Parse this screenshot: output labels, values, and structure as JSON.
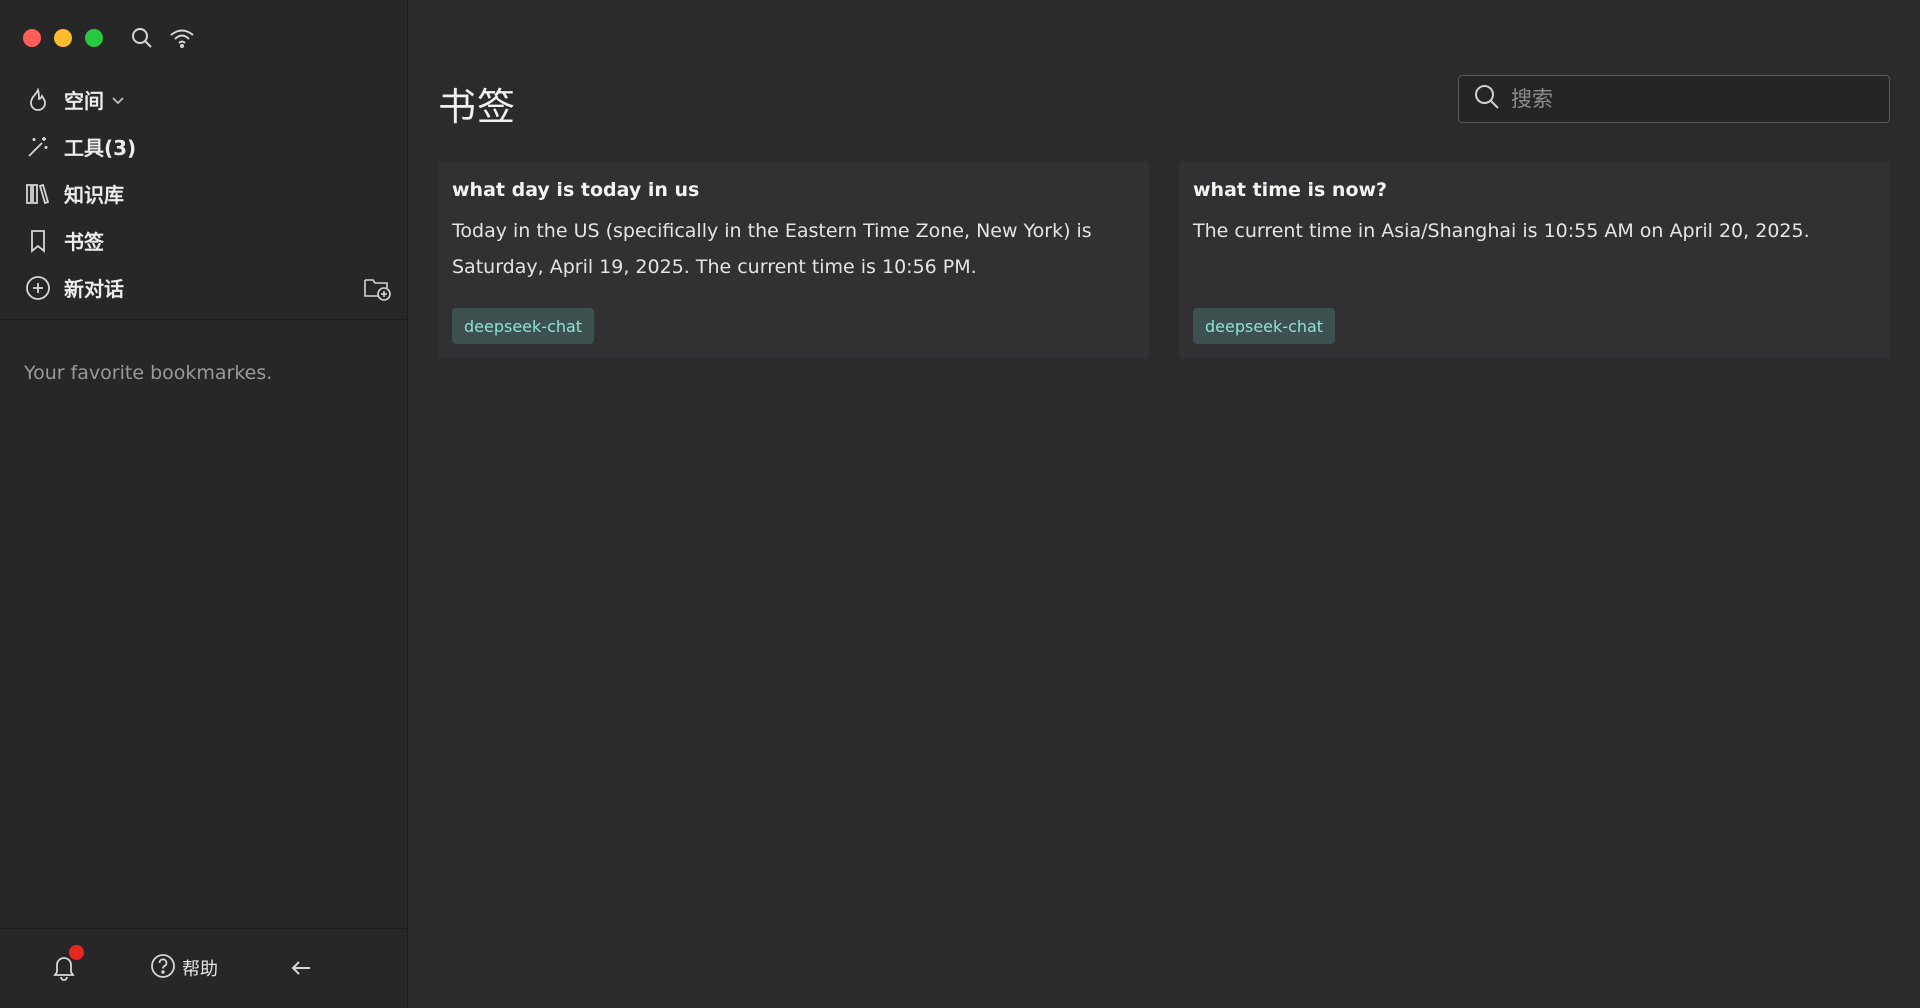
{
  "sidebar": {
    "nav": [
      {
        "label": "空间",
        "icon": "flame-icon"
      },
      {
        "label": "工具(3)",
        "icon": "magic-wand-icon"
      },
      {
        "label": "知识库",
        "icon": "library-icon"
      },
      {
        "label": "书签",
        "icon": "bookmark-icon"
      },
      {
        "label": "新对话",
        "icon": "plus-circle-icon"
      }
    ],
    "hint": "Your favorite bookmarkes.",
    "footer": {
      "help_label": "帮助"
    }
  },
  "main": {
    "title": "书签",
    "search": {
      "placeholder": "搜索",
      "value": ""
    },
    "bookmarks": [
      {
        "title": "what day is today in us",
        "body": "Today in the US (specifically in the Eastern Time Zone, New York) is Saturday, April 19, 2025. The current time is 10:56 PM.",
        "tag": "deepseek-chat"
      },
      {
        "title": "what time is now?",
        "body": "The current time in Asia/Shanghai is 10:55 AM on April 20, 2025.",
        "tag": "deepseek-chat"
      }
    ]
  },
  "colors": {
    "background": "#2b2b2c",
    "sidebar": "#272728",
    "card": "#313133",
    "tag_bg": "#3d5150",
    "tag_text": "#8fe3d6",
    "notification_dot": "#e8281f"
  }
}
